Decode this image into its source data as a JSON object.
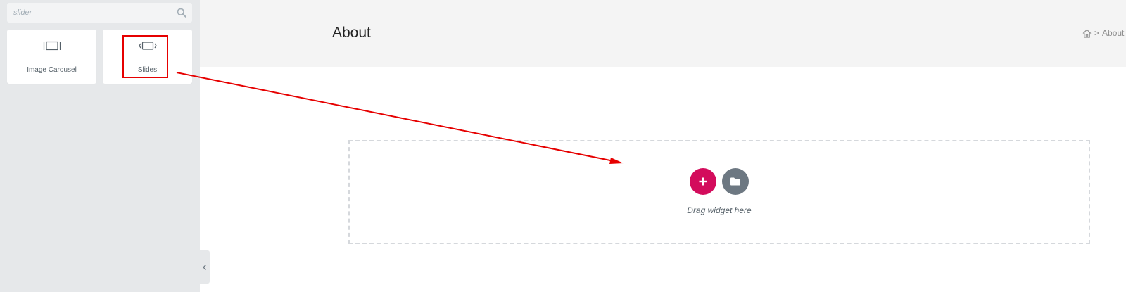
{
  "search": {
    "value": "slider",
    "icon": "search-icon"
  },
  "widgets": [
    {
      "label": "Image Carousel",
      "icon": "image-carousel-icon"
    },
    {
      "label": "Slides",
      "icon": "slides-icon"
    }
  ],
  "page": {
    "title": "About"
  },
  "breadcrumb": {
    "home_icon": "home-icon",
    "separator": ">",
    "current": "About"
  },
  "drop_zone": {
    "hint": "Drag widget here",
    "add_icon": "plus-icon",
    "template_icon": "folder-icon"
  },
  "colors": {
    "accent": "#d30c5c",
    "highlight": "#e60000",
    "sidebar_bg": "#e6e8ea",
    "header_bg": "#f4f4f4"
  }
}
